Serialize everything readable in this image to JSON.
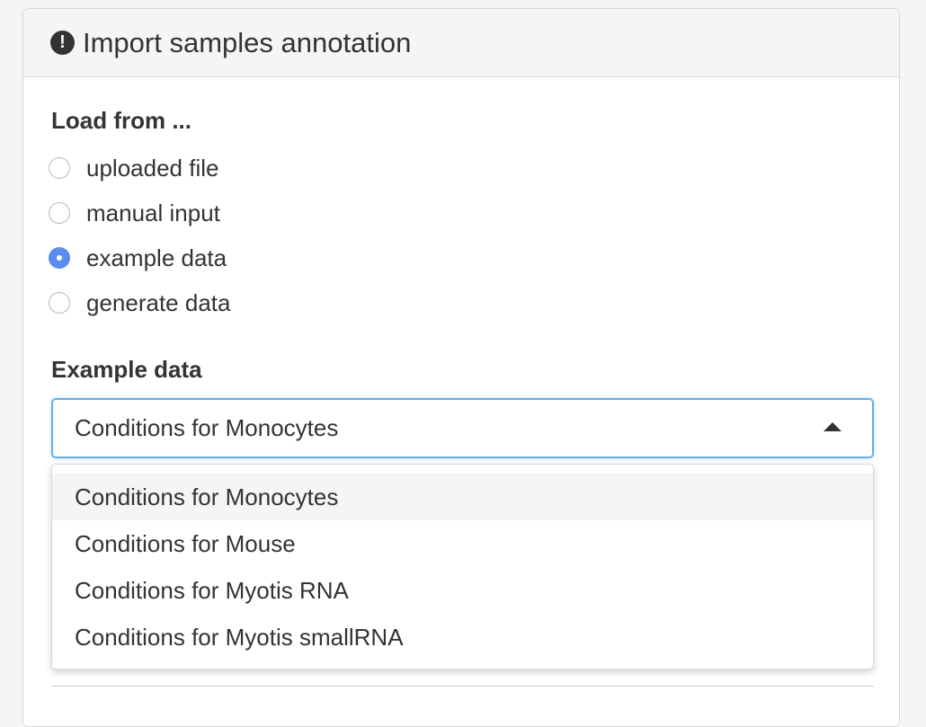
{
  "panel": {
    "title": "Import samples annotation",
    "header_icon": "exclamation-circle-icon",
    "header_icon_glyph": "!"
  },
  "load_from": {
    "label": "Load from ...",
    "options": [
      {
        "label": "uploaded file",
        "checked": false
      },
      {
        "label": "manual input",
        "checked": false
      },
      {
        "label": "example data",
        "checked": true
      },
      {
        "label": "generate data",
        "checked": false
      }
    ]
  },
  "example_data": {
    "label": "Example data",
    "selected": "Conditions for Monocytes",
    "dropdown_open": true,
    "options": [
      "Conditions for Monocytes",
      "Conditions for Mouse",
      "Conditions for Myotis RNA",
      "Conditions for Myotis smallRNA"
    ]
  },
  "colors": {
    "accent": "#5b8def",
    "focus_border": "#66afe9",
    "text": "#333333",
    "header_bg": "#f5f5f5"
  }
}
